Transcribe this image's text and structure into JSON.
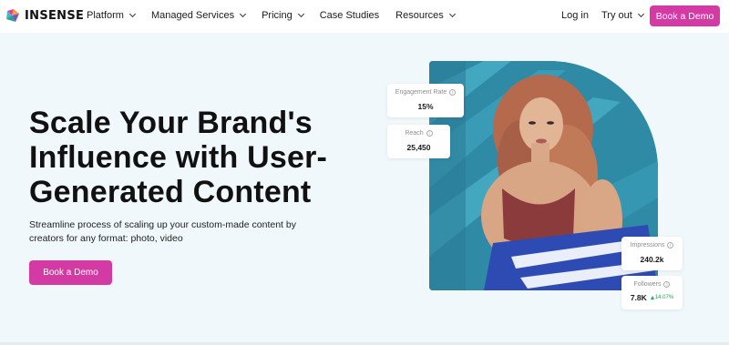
{
  "brand": {
    "name": "INSENSE",
    "accent": "#d43aa4"
  },
  "nav": {
    "items": [
      {
        "label": "Platform",
        "has_dropdown": true
      },
      {
        "label": "Managed Services",
        "has_dropdown": true
      },
      {
        "label": "Pricing",
        "has_dropdown": true
      },
      {
        "label": "Case Studies",
        "has_dropdown": false
      },
      {
        "label": "Resources",
        "has_dropdown": true
      }
    ],
    "login_label": "Log in",
    "tryout_label": "Try out",
    "cta_label": "Book a Demo"
  },
  "hero": {
    "headline": "Scale Your Brand's Influence with User-Generated Content",
    "subhead": "Streamline process of scaling up your custom-made content by creators for any format: photo, video",
    "cta_label": "Book a Demo"
  },
  "stats": {
    "engagement": {
      "label": "Engagement Rate",
      "value": "15%"
    },
    "reach": {
      "label": "Reach",
      "value": "25,450"
    },
    "impressions": {
      "label": "Impressions",
      "value": "240.2k"
    },
    "followers": {
      "label": "Followers",
      "value": "7.8K",
      "growth": "14.07%"
    }
  }
}
